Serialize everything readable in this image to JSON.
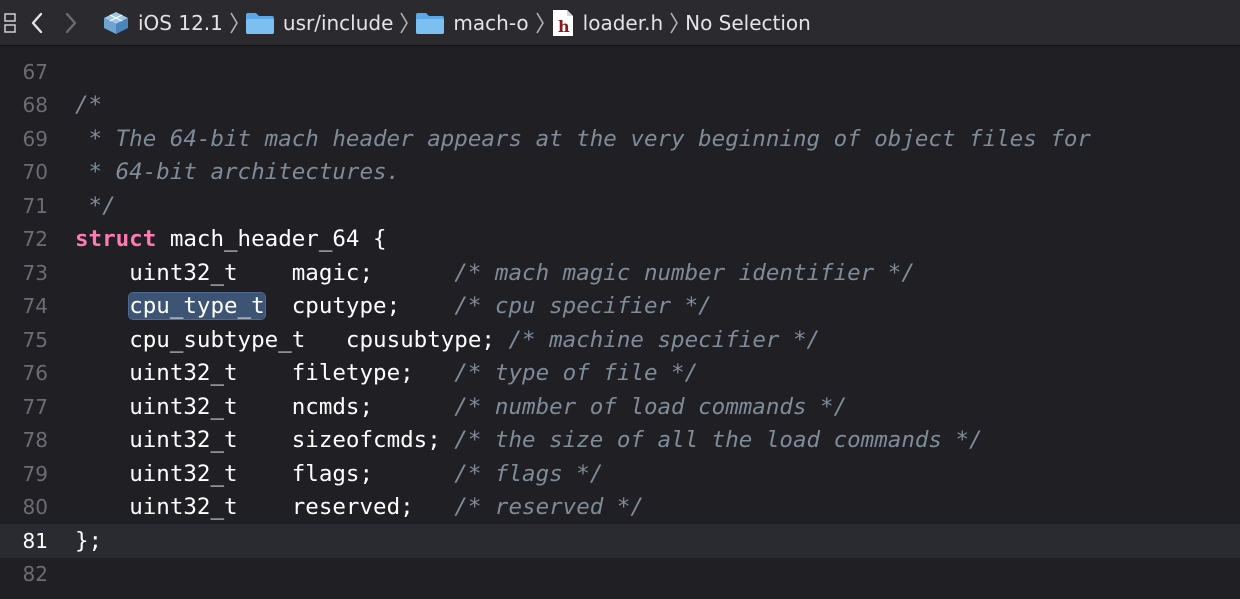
{
  "jumpbar": {
    "crumbs": [
      {
        "label": "iOS 12.1",
        "icon": "sdk-icon"
      },
      {
        "label": "usr/include",
        "icon": "folder-icon"
      },
      {
        "label": "mach-o",
        "icon": "folder-icon"
      },
      {
        "label": "loader.h",
        "icon": "header-file-icon"
      },
      {
        "label": "No Selection",
        "icon": ""
      }
    ],
    "header_glyph": "h"
  },
  "editor": {
    "current_line": "81",
    "lines": [
      {
        "no": "67",
        "indent": "",
        "kw": "",
        "text": "",
        "comment": ""
      },
      {
        "no": "68",
        "indent": "",
        "kw": "",
        "text": "",
        "comment": "/*"
      },
      {
        "no": "69",
        "indent": "",
        "kw": "",
        "text": "",
        "comment": " * The 64-bit mach header appears at the very beginning of object files for"
      },
      {
        "no": "70",
        "indent": "",
        "kw": "",
        "text": "",
        "comment": " * 64-bit architectures."
      },
      {
        "no": "71",
        "indent": "",
        "kw": "",
        "text": "",
        "comment": " */"
      },
      {
        "no": "72",
        "indent": "",
        "kw": "struct",
        "text": " mach_header_64 {",
        "comment": ""
      },
      {
        "no": "73",
        "indent": "    ",
        "kw": "",
        "text": "uint32_t    magic;      ",
        "comment": "/* mach magic number identifier */"
      },
      {
        "no": "74",
        "indent": "    ",
        "kw": "",
        "text": "",
        "comment": "/* cpu specifier */",
        "hl": "cpu_type_t",
        "after_hl": "  cputype;    "
      },
      {
        "no": "75",
        "indent": "    ",
        "kw": "",
        "text": "cpu_subtype_t   cpusubtype; ",
        "comment": "/* machine specifier */"
      },
      {
        "no": "76",
        "indent": "    ",
        "kw": "",
        "text": "uint32_t    filetype;   ",
        "comment": "/* type of file */"
      },
      {
        "no": "77",
        "indent": "    ",
        "kw": "",
        "text": "uint32_t    ncmds;      ",
        "comment": "/* number of load commands */"
      },
      {
        "no": "78",
        "indent": "    ",
        "kw": "",
        "text": "uint32_t    sizeofcmds; ",
        "comment": "/* the size of all the load commands */"
      },
      {
        "no": "79",
        "indent": "    ",
        "kw": "",
        "text": "uint32_t    flags;      ",
        "comment": "/* flags */"
      },
      {
        "no": "80",
        "indent": "    ",
        "kw": "",
        "text": "uint32_t    reserved;   ",
        "comment": "/* reserved */"
      },
      {
        "no": "81",
        "indent": "",
        "kw": "",
        "text": "};",
        "comment": ""
      },
      {
        "no": "82",
        "indent": "",
        "kw": "",
        "text": "",
        "comment": ""
      }
    ]
  },
  "colors": {
    "background": "#1f1f24",
    "keyword": "#ff7ab2",
    "comment": "#7f8c98",
    "plain": "#ffffff",
    "line_number": "#6c6c72",
    "selection": "#3d5474"
  }
}
